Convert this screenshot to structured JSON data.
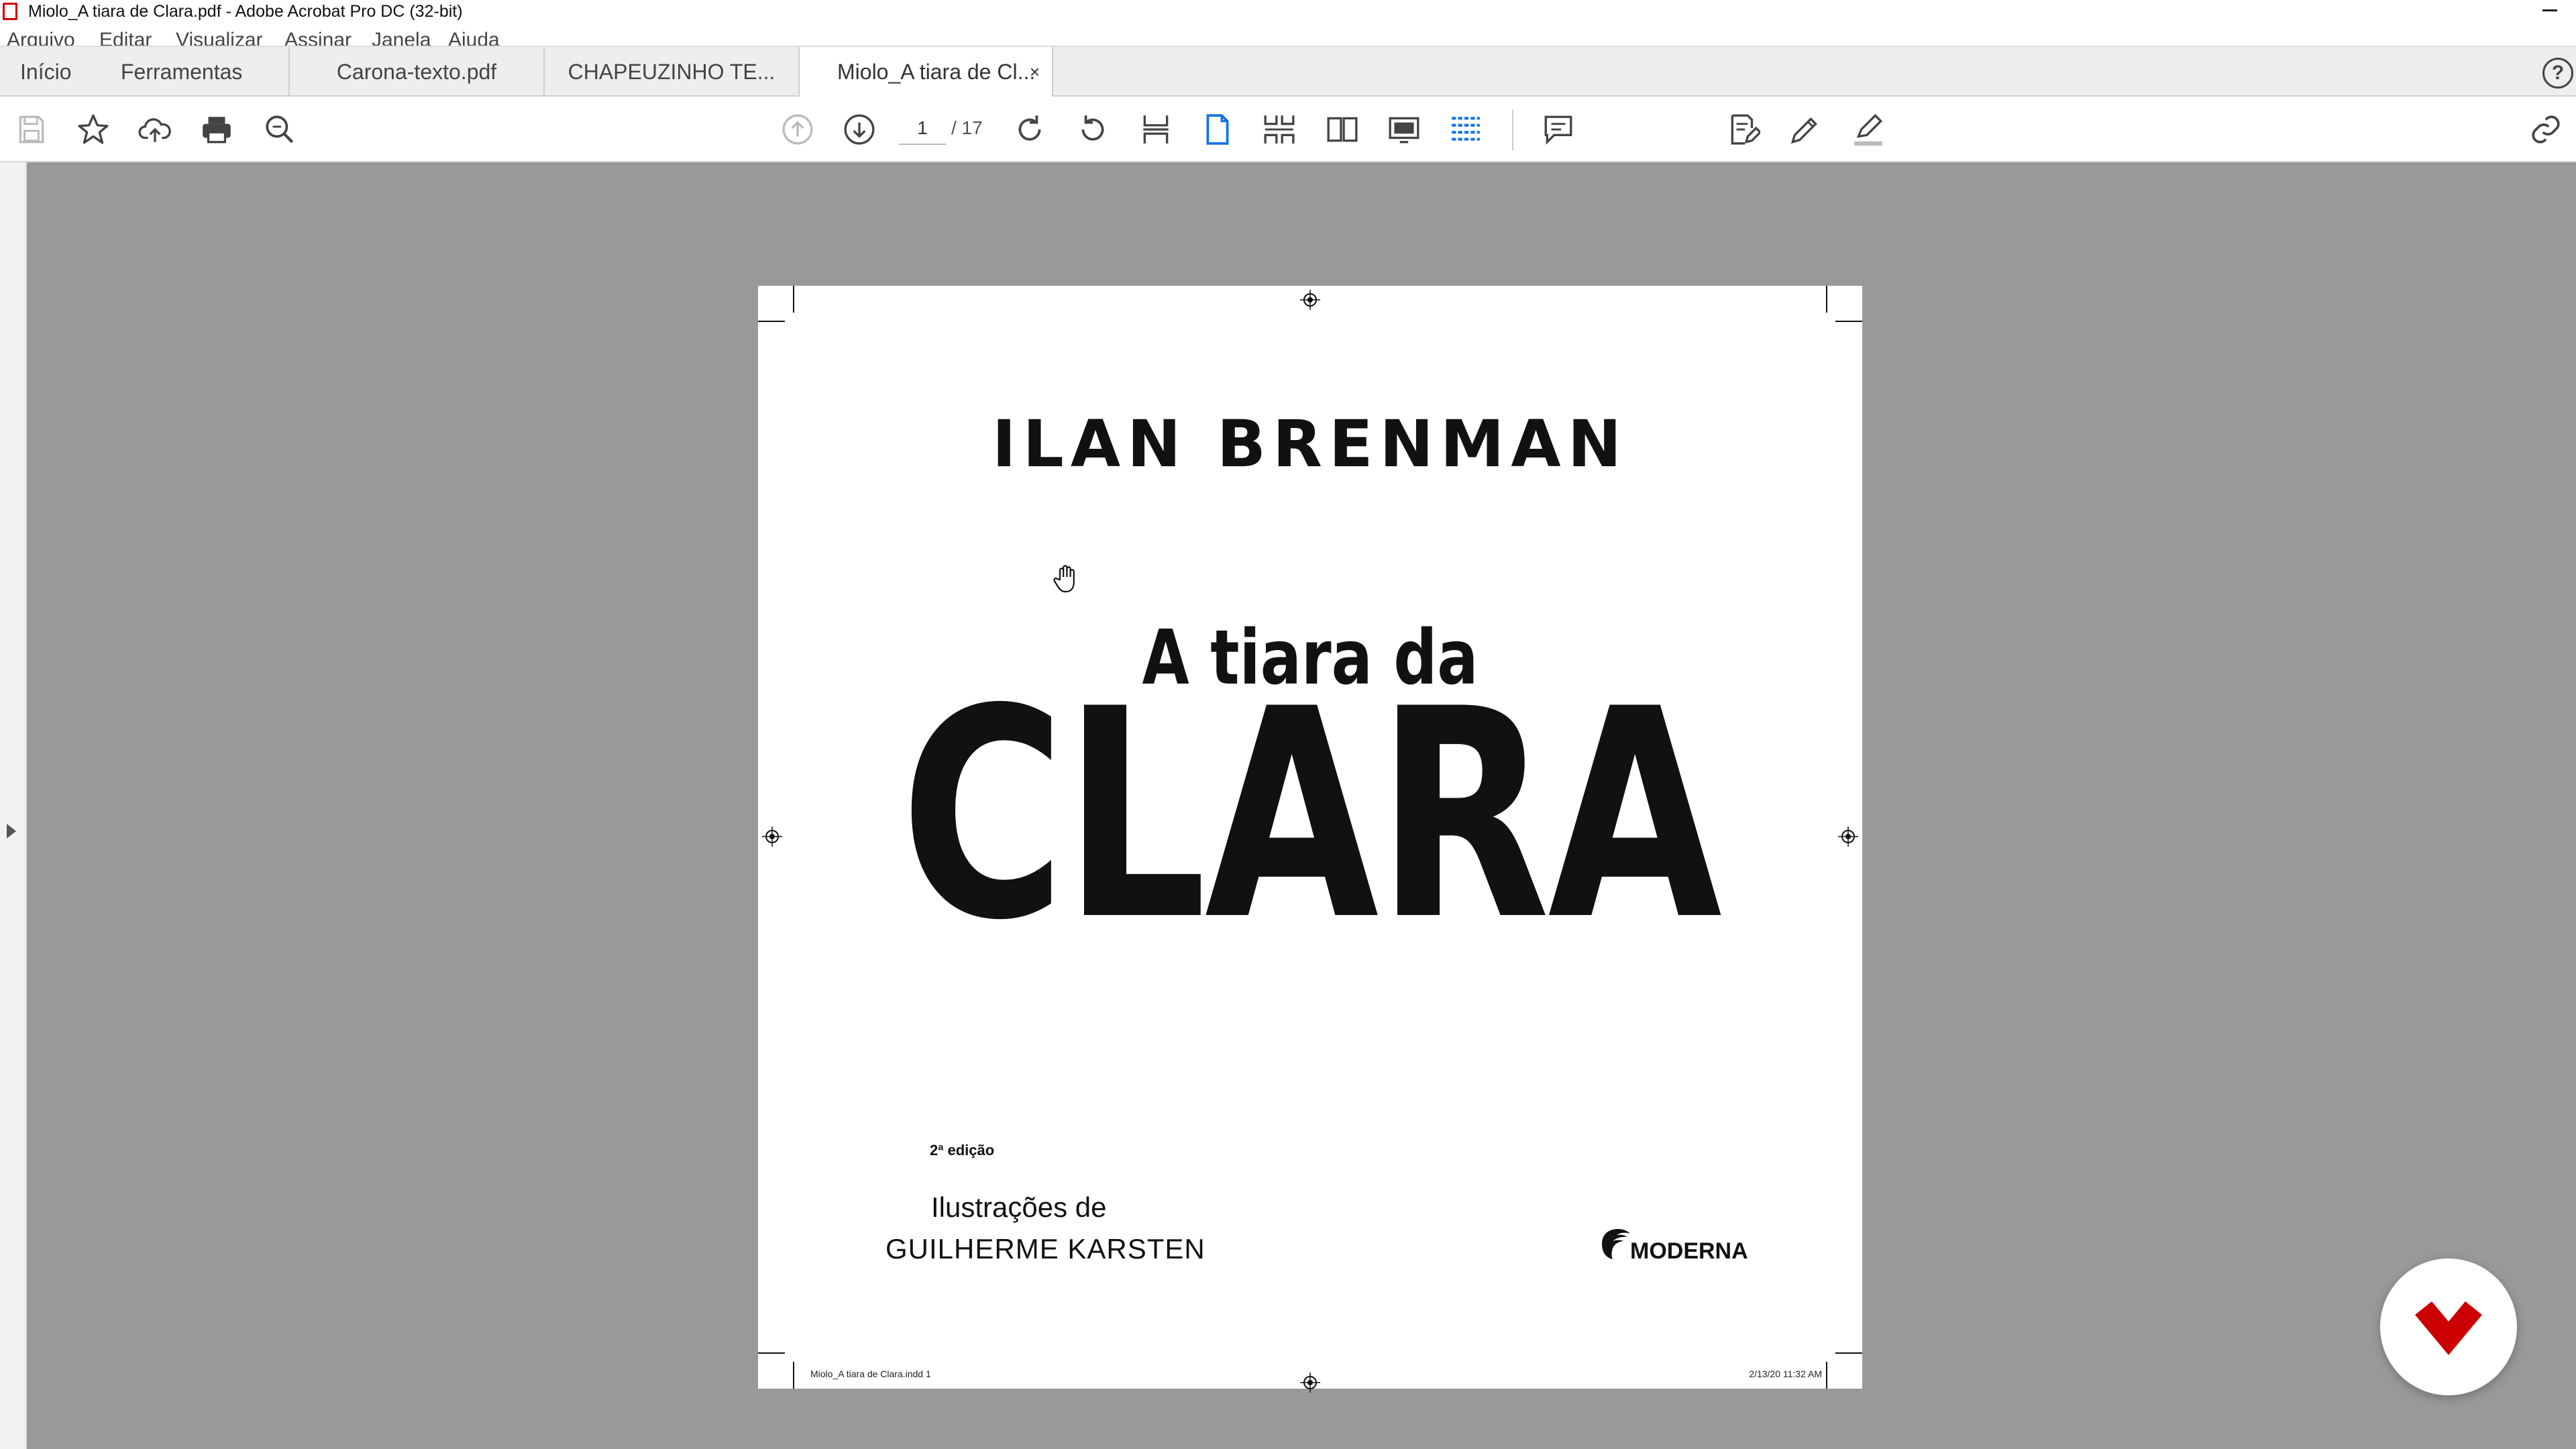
{
  "window": {
    "title": "Miolo_A tiara de Clara.pdf - Adobe Acrobat Pro DC (32-bit)"
  },
  "menubar": {
    "items": [
      "Arquivo",
      "Editar",
      "Visualizar",
      "Assinar",
      "Janela",
      "Ajuda"
    ]
  },
  "tabs": {
    "home": "Início",
    "tools": "Ferramentas",
    "documents": [
      {
        "label": "Carona-texto.pdf"
      },
      {
        "label": "CHAPEUZINHO TE..."
      },
      {
        "label": "Miolo_A tiara de Cl...",
        "close": "×"
      }
    ],
    "help": "?"
  },
  "toolbar": {
    "current_page": "1",
    "total_pages": "/ 17",
    "icons": [
      "save-icon",
      "bookmark-star-icon",
      "upload-cloud-icon",
      "print-icon",
      "zoom-search-icon",
      "page-up-icon",
      "page-down-icon",
      "rotate-clockwise-icon",
      "rotate-counterclockwise-icon",
      "fit-width-icon",
      "single-page-icon",
      "two-page-scroll-icon",
      "two-page-icon",
      "presentation-icon",
      "scrolling-icon",
      "comment-icon",
      "fill-sign-icon",
      "pencil-icon",
      "highlighter-icon",
      "share-link-icon"
    ]
  },
  "document": {
    "author": "ILAN BRENMAN",
    "title_line1": "A tiara da",
    "title_line2": "CLARA",
    "edition": "2ª edição",
    "illustrations_label": "Ilustrações de",
    "illustrator": "GUILHERME KARSTEN",
    "publisher": "MODERNA",
    "slug_left": "Miolo_A tiara de Clara.indd   1",
    "slug_right": "2/13/20   11:32 AM"
  },
  "colors": {
    "workspace": "#999999",
    "brand_badge": "#cc0000",
    "active_tool": "#1473e6"
  }
}
